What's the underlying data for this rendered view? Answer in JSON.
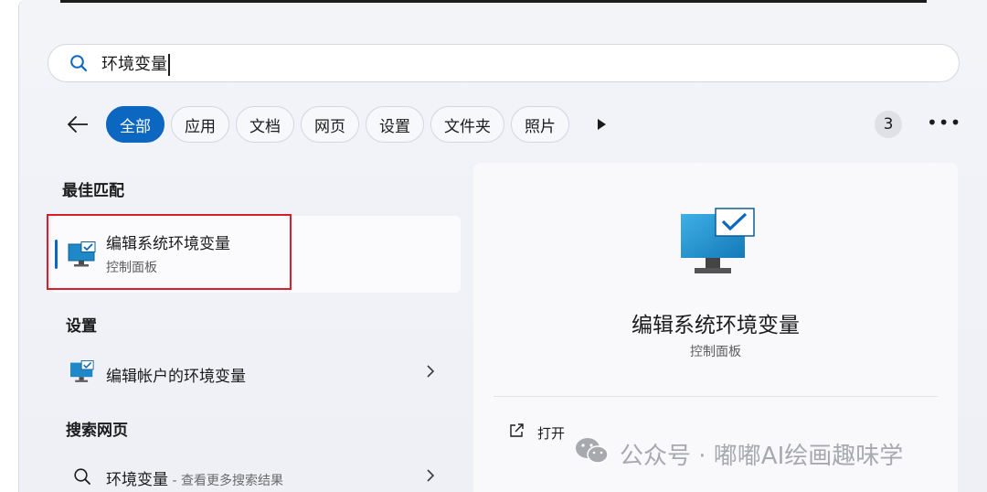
{
  "search": {
    "value": "环境变量"
  },
  "filters": {
    "chips": [
      "全部",
      "应用",
      "文档",
      "网页",
      "设置",
      "文件夹",
      "照片"
    ],
    "result_count": "3"
  },
  "best_match": {
    "section_label": "最佳匹配",
    "title": "编辑系统环境变量",
    "subtitle": "控制面板"
  },
  "settings": {
    "section_label": "设置",
    "item_title": "编辑帐户的环境变量"
  },
  "web": {
    "section_label": "搜索网页",
    "query": "环境变量",
    "hint": " - 查看更多搜索结果"
  },
  "detail": {
    "title": "编辑系统环境变量",
    "subtitle": "控制面板",
    "open_label": "打开"
  },
  "watermark": {
    "text": "公众号 · 嘟嘟AI绘画趣味学"
  },
  "colors": {
    "accent": "#0b67c0",
    "highlight": "#d81e2a"
  },
  "icons": [
    "search-icon",
    "back-arrow-icon",
    "more-filters-icon",
    "ellipsis-icon",
    "monitor-check-icon",
    "chevron-right-icon",
    "open-external-icon",
    "wechat-icon"
  ]
}
